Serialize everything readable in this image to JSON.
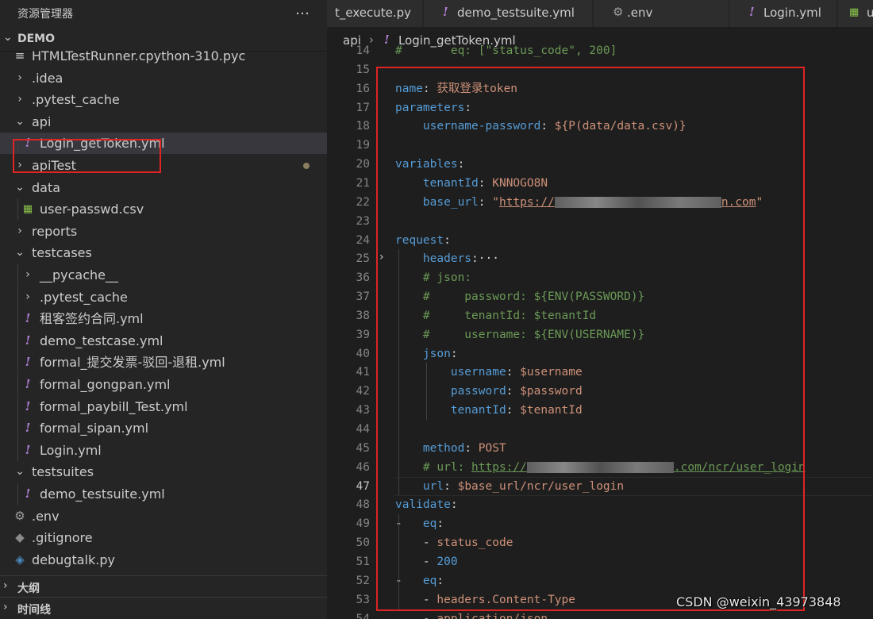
{
  "sidebar": {
    "title": "资源管理器",
    "more_icon": "…",
    "section_label": "DEMO",
    "tree": [
      {
        "label": "HTMLTestRunner.cpython-310.pyc",
        "icon": "doc",
        "indent": 1
      },
      {
        "label": ".idea",
        "icon": "chev-right",
        "indent": 1
      },
      {
        "label": ".pytest_cache",
        "icon": "chev-right",
        "indent": 1
      },
      {
        "label": "api",
        "icon": "chev-down",
        "indent": 1
      },
      {
        "label": "Login_getToken.yml",
        "icon": "yml",
        "indent": 2,
        "selected": true
      },
      {
        "label": "apiTest",
        "icon": "chev-right",
        "indent": 1,
        "modified": true
      },
      {
        "label": "data",
        "icon": "chev-down",
        "indent": 1
      },
      {
        "label": "user-passwd.csv",
        "icon": "csv",
        "indent": 2
      },
      {
        "label": "reports",
        "icon": "chev-right",
        "indent": 1
      },
      {
        "label": "testcases",
        "icon": "chev-down",
        "indent": 1
      },
      {
        "label": "__pycache__",
        "icon": "chev-right",
        "indent": 2
      },
      {
        "label": ".pytest_cache",
        "icon": "chev-right",
        "indent": 2
      },
      {
        "label": "租客签约合同.yml",
        "icon": "yml",
        "indent": 2
      },
      {
        "label": "demo_testcase.yml",
        "icon": "yml",
        "indent": 2
      },
      {
        "label": "formal_提交发票-驳回-退租.yml",
        "icon": "yml",
        "indent": 2
      },
      {
        "label": "formal_gongpan.yml",
        "icon": "yml",
        "indent": 2
      },
      {
        "label": "formal_paybill_Test.yml",
        "icon": "yml",
        "indent": 2
      },
      {
        "label": "formal_sipan.yml",
        "icon": "yml",
        "indent": 2
      },
      {
        "label": "Login.yml",
        "icon": "yml",
        "indent": 2
      },
      {
        "label": "testsuites",
        "icon": "chev-down",
        "indent": 1
      },
      {
        "label": "demo_testsuite.yml",
        "icon": "yml",
        "indent": 2
      },
      {
        "label": ".env",
        "icon": "gear",
        "indent": 1
      },
      {
        "label": ".gitignore",
        "icon": "git",
        "indent": 1
      },
      {
        "label": "debugtalk.py",
        "icon": "py",
        "indent": 1
      }
    ],
    "outline_label": "大纲",
    "timeline_label": "时间线"
  },
  "tabs": [
    {
      "label": "t_execute.py",
      "icon": "none"
    },
    {
      "label": "demo_testsuite.yml",
      "icon": "yml"
    },
    {
      "label": ".env",
      "icon": "gear"
    },
    {
      "label": "Login.yml",
      "icon": "yml"
    },
    {
      "label": "u",
      "icon": "csv"
    }
  ],
  "breadcrumb": {
    "folder": "api",
    "separator": "›",
    "file": "Login_getToken.yml"
  },
  "editor": {
    "current_line": 47,
    "lines": [
      {
        "n": 14,
        "html": "<span class=\"c\">#       eq: [\"status_code\", 200]</span>"
      },
      {
        "n": 15,
        "html": ""
      },
      {
        "n": 16,
        "html": "<span class=\"k\">name</span>: <span class=\"s\">获取登录token</span>"
      },
      {
        "n": 17,
        "html": "<span class=\"k\">parameters</span>:"
      },
      {
        "n": 18,
        "html": "    <span class=\"k\">username-password</span>: <span class=\"s\">${P(data/data.csv)}</span>"
      },
      {
        "n": 19,
        "html": ""
      },
      {
        "n": 20,
        "html": "<span class=\"k\">variables</span>:"
      },
      {
        "n": 21,
        "html": "    <span class=\"k\">tenantId</span>: <span class=\"s\">KNNOGO8N</span>"
      },
      {
        "n": 22,
        "html": "    <span class=\"k\">base_url</span>: <span class=\"s\">\"</span><span class=\"u\">https://<span class=\"blur\" style=\"width:210px\"></span>n.com</span><span class=\"s\">\"</span>"
      },
      {
        "n": 23,
        "html": ""
      },
      {
        "n": 24,
        "html": "<span class=\"k\">request</span>:"
      },
      {
        "n": 25,
        "html": "    <span class=\"k\">headers</span>:<span class=\"pu\">···</span>"
      },
      {
        "n": 36,
        "html": "    <span class=\"c\"># json:</span>"
      },
      {
        "n": 37,
        "html": "    <span class=\"c\">#     password: ${ENV(PASSWORD)}</span>"
      },
      {
        "n": 38,
        "html": "    <span class=\"c\">#     tenantId: $tenantId</span>"
      },
      {
        "n": 39,
        "html": "    <span class=\"c\">#     username: ${ENV(USERNAME)}</span>"
      },
      {
        "n": 40,
        "html": "    <span class=\"k\">json</span>:"
      },
      {
        "n": 41,
        "html": "        <span class=\"k\">username</span>: <span class=\"s\">$username</span>"
      },
      {
        "n": 42,
        "html": "        <span class=\"k\">password</span>: <span class=\"s\">$password</span>"
      },
      {
        "n": 43,
        "html": "        <span class=\"k\">tenantId</span>: <span class=\"s\">$tenantId</span>"
      },
      {
        "n": 44,
        "html": ""
      },
      {
        "n": 45,
        "html": "    <span class=\"k\">method</span>: <span class=\"s\">POST</span>"
      },
      {
        "n": 46,
        "html": "    <span class=\"c\"># url: </span><span class=\"cu\">https://<span class=\"blur\" style=\"width:185px\"></span>.com/ncr/user_login</span>"
      },
      {
        "n": 47,
        "html": "    <span class=\"k\">url</span>: <span class=\"s\">$base_url/ncr/user_login</span>"
      },
      {
        "n": 48,
        "html": "<span class=\"k\">validate</span>:"
      },
      {
        "n": 49,
        "html": "-   <span class=\"k\">eq</span>:"
      },
      {
        "n": 50,
        "html": "    - <span class=\"s\">status_code</span>"
      },
      {
        "n": 51,
        "html": "    - <span class=\"k\">200</span>"
      },
      {
        "n": 52,
        "html": "-   <span class=\"k\">eq</span>:"
      },
      {
        "n": 53,
        "html": "    - <span class=\"s\">headers.Content-Type</span>"
      },
      {
        "n": 54,
        "html": "    - <span class=\"s\">application/json</span>"
      }
    ]
  },
  "watermark": "CSDN @weixin_43973848",
  "colors": {
    "highlight_box": "#e02424",
    "keyword": "#569cd6",
    "string": "#ce9178",
    "comment": "#6a9955",
    "yaml_icon": "#b180d7"
  }
}
